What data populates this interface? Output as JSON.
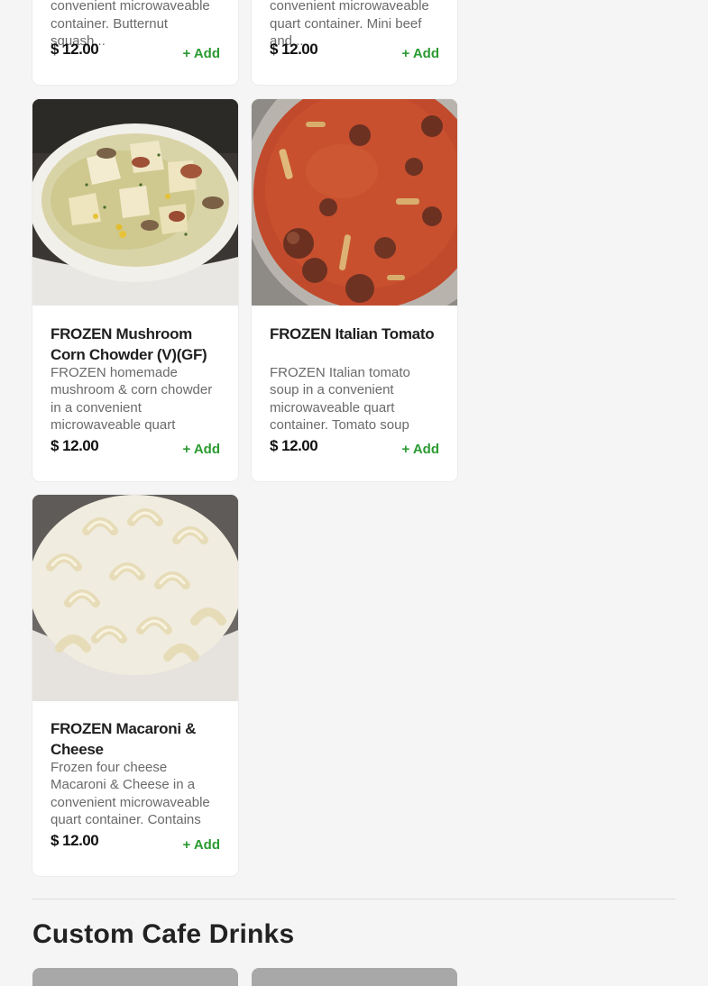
{
  "items": [
    {
      "desc": "butternut squash soup in a convenient microwaveable container. Butternut squash...",
      "price": "$ 12.00",
      "add_label": "+ Add"
    },
    {
      "desc": "Italian wedding soup in a convenient microwaveable quart container. Mini beef and...",
      "price": "$ 12.00",
      "add_label": "+ Add"
    },
    {
      "title": "FROZEN Mushroom Corn Chowder (V)(GF)",
      "desc": "FROZEN homemade mushroom & corn chowder in a convenient microwaveable quart container. Mushrooms...",
      "price": "$ 12.00",
      "add_label": "+ Add"
    },
    {
      "title": "FROZEN Italian Tomato",
      "desc": "FROZEN Italian tomato soup in a convenient microwaveable quart container. Tomato soup loaded wit...",
      "price": "$ 12.00",
      "add_label": "+ Add"
    },
    {
      "title": "FROZEN Macaroni & Cheese",
      "desc": "Frozen four cheese Macaroni & Cheese in a convenient microwaveable quart container. Contains wheat...",
      "price": "$ 12.00",
      "add_label": "+ Add"
    }
  ],
  "section": {
    "title": "Custom Cafe Drinks"
  },
  "colors": {
    "add": "#2a9a30",
    "price": "#111111",
    "description": "#6a6a6a"
  }
}
